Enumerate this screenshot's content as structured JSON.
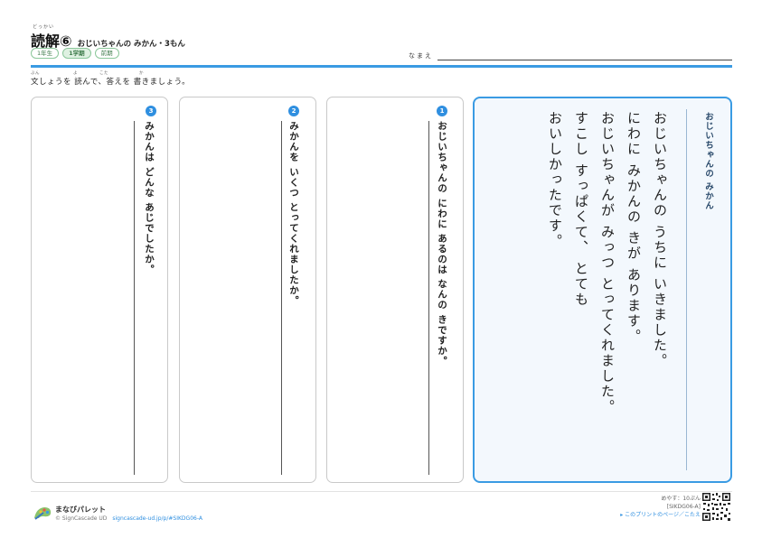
{
  "header": {
    "title_ruby": "どっかい",
    "title_main": "読解⑥",
    "title_sub": "おじいちゃんの みかん・3もん",
    "tags": [
      "1年生",
      "1学期",
      "前期"
    ],
    "name_label": "なまえ"
  },
  "instruction": {
    "text": "文しょうを 読んで、答えを 書きましょう。",
    "ruby": [
      "ぶん",
      "よ",
      "こた",
      "か"
    ]
  },
  "questions": [
    {
      "number": "3",
      "text": "みかんは どんな あじでしたか。"
    },
    {
      "number": "2",
      "text": "みかんを いくつ とってくれましたか。"
    },
    {
      "number": "1",
      "text": "おじいちゃんの にわに あるのは なんの きですか。"
    }
  ],
  "story": {
    "title": "おじいちゃんの みかん",
    "lines": [
      "おじいちゃんの うちに いきました。",
      "にわに みかんの きが あります。",
      "おじいちゃんが みっつ とってくれました。",
      "すこし すっぱくて、 とても",
      "おいしかったです。"
    ]
  },
  "footer": {
    "brand_name": "まなびパレット",
    "copyright": "© SignCascade UD",
    "url": "signcascade-ud.jp/p/#SIKDG06-A",
    "time_label": "めやす：10ぷん",
    "code": "[SIKDG06-A]",
    "answer_link": "▸ このプリントのページ／こたえ"
  }
}
